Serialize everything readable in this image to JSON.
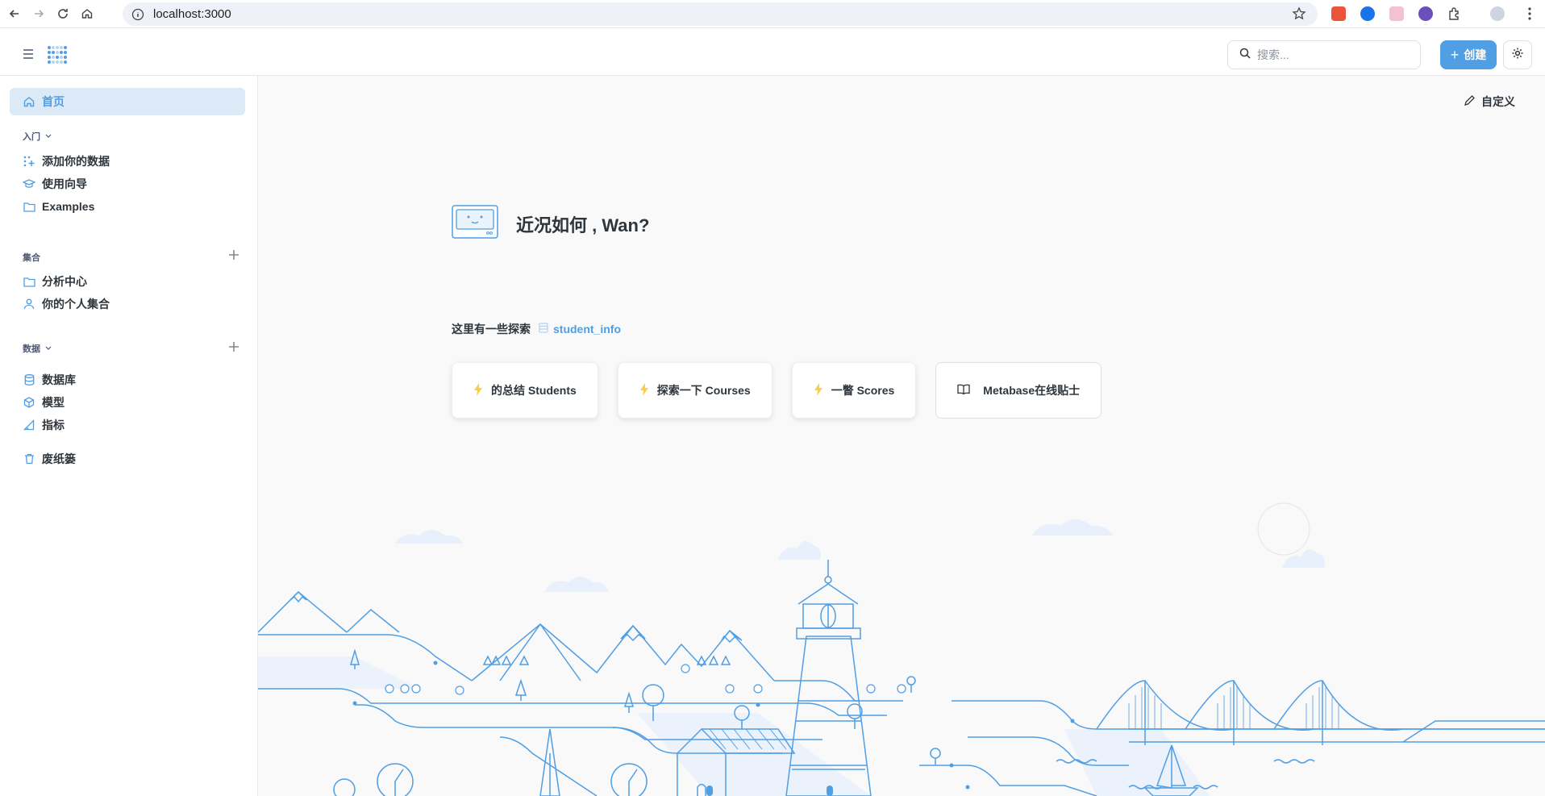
{
  "browser": {
    "url": "localhost:3000"
  },
  "header": {
    "search_placeholder": "搜索...",
    "create_label": "创建"
  },
  "sidebar": {
    "home_label": "首页",
    "getting_started": {
      "title": "入门",
      "items": [
        {
          "label": "添加你的数据",
          "icon": "add-data-icon"
        },
        {
          "label": "使用向导",
          "icon": "graduation-cap-icon"
        },
        {
          "label": "Examples",
          "icon": "folder-icon"
        }
      ]
    },
    "collections": {
      "title": "集合",
      "items": [
        {
          "label": "分析中心",
          "icon": "folder-icon"
        },
        {
          "label": "你的个人集合",
          "icon": "person-icon"
        }
      ]
    },
    "data": {
      "title": "数据",
      "items": [
        {
          "label": "数据库",
          "icon": "database-icon"
        },
        {
          "label": "模型",
          "icon": "model-cube-icon"
        },
        {
          "label": "指标",
          "icon": "metric-icon"
        }
      ]
    },
    "trash_label": "废纸篓"
  },
  "main": {
    "customize_label": "自定义",
    "greeting": "近况如何 , Wan?",
    "explore_label": "这里有一些探索",
    "explore_table": "student_info",
    "cards": [
      {
        "label": "的总结 Students",
        "icon": "bolt-icon"
      },
      {
        "label": "探索一下 Courses",
        "icon": "bolt-icon"
      },
      {
        "label": "一瞥 Scores",
        "icon": "bolt-icon"
      },
      {
        "label": "Metabase在线贴士",
        "icon": "book-icon"
      }
    ]
  },
  "colors": {
    "brand": "#509ee3",
    "bolt": "#f9cf48",
    "illustration_line": "#509ee3",
    "active_bg": "#dce9f7"
  }
}
